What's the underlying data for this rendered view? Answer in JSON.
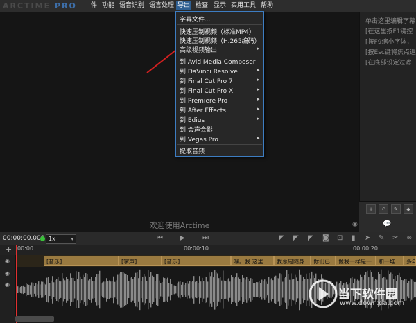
{
  "app": {
    "logo": "ARCTIME",
    "logo_pro": "PRO"
  },
  "menubar": {
    "items": [
      {
        "label": "件"
      },
      {
        "label": "功能"
      },
      {
        "label": "语音识别"
      },
      {
        "label": "语言处理"
      },
      {
        "label": "导出"
      },
      {
        "label": "检查"
      },
      {
        "label": "显示"
      },
      {
        "label": "实用工具"
      },
      {
        "label": "帮助"
      }
    ]
  },
  "export_menu": {
    "items": [
      {
        "label": "字幕文件..."
      },
      {
        "label": "快速压制视频（标准MP4）"
      },
      {
        "label": "快速压制视频（H.265编码）"
      },
      {
        "label": "高级视频输出"
      },
      {
        "label": "到 Avid Media Composer"
      },
      {
        "label": "到 DaVinci Resolve"
      },
      {
        "label": "到 Final Cut Pro 7"
      },
      {
        "label": "到 Final Cut Pro X"
      },
      {
        "label": "到 Premiere Pro"
      },
      {
        "label": "到 After Effects"
      },
      {
        "label": "到 Edius"
      },
      {
        "label": "到 会声会影"
      },
      {
        "label": "到 Vegas Pro"
      },
      {
        "label": "提取音频"
      }
    ],
    "submenu_arrow": "▸"
  },
  "video": {
    "welcome": "欢迎使用Arctime"
  },
  "right_panel": {
    "hints": [
      "单击这里编辑字幕",
      "[在这里按F1键控",
      "[按F9缩小字体，",
      "[按Esc键将焦点返",
      "[在底部设定过滤"
    ]
  },
  "transport": {
    "timecode": "00:00:00.000",
    "speed": "1x"
  },
  "ruler": {
    "labels": [
      "00:00",
      "00:00:10",
      "00:00:20"
    ]
  },
  "subtitles": [
    {
      "text": "[音乐]"
    },
    {
      "text": "[掌声]"
    },
    {
      "text": "[音乐]"
    },
    {
      "text": "嘿。我 这里..."
    },
    {
      "text": "我总是随身..."
    },
    {
      "text": "你们已..."
    },
    {
      "text": "像我一样是一..."
    },
    {
      "text": "和一堆"
    },
    {
      "text": "多年"
    }
  ],
  "watermark": {
    "text": "当下软件园",
    "url": "www.downxia.com"
  },
  "colors": {
    "accent": "#2f5f92",
    "menu_border": "#3d7dc2",
    "subtitle_block": "#9a7a40",
    "playhead": "#e03030",
    "arrow": "#d42020"
  },
  "icons": {
    "arrow_down": "▾",
    "play": "▶",
    "prev": "⏮",
    "next": "⏭",
    "eye": "◉",
    "add": "+",
    "camera": "camera-icon",
    "trash": "trash-icon",
    "undo": "undo-icon",
    "pencil": "pencil-icon",
    "chat": "chat-icon"
  }
}
